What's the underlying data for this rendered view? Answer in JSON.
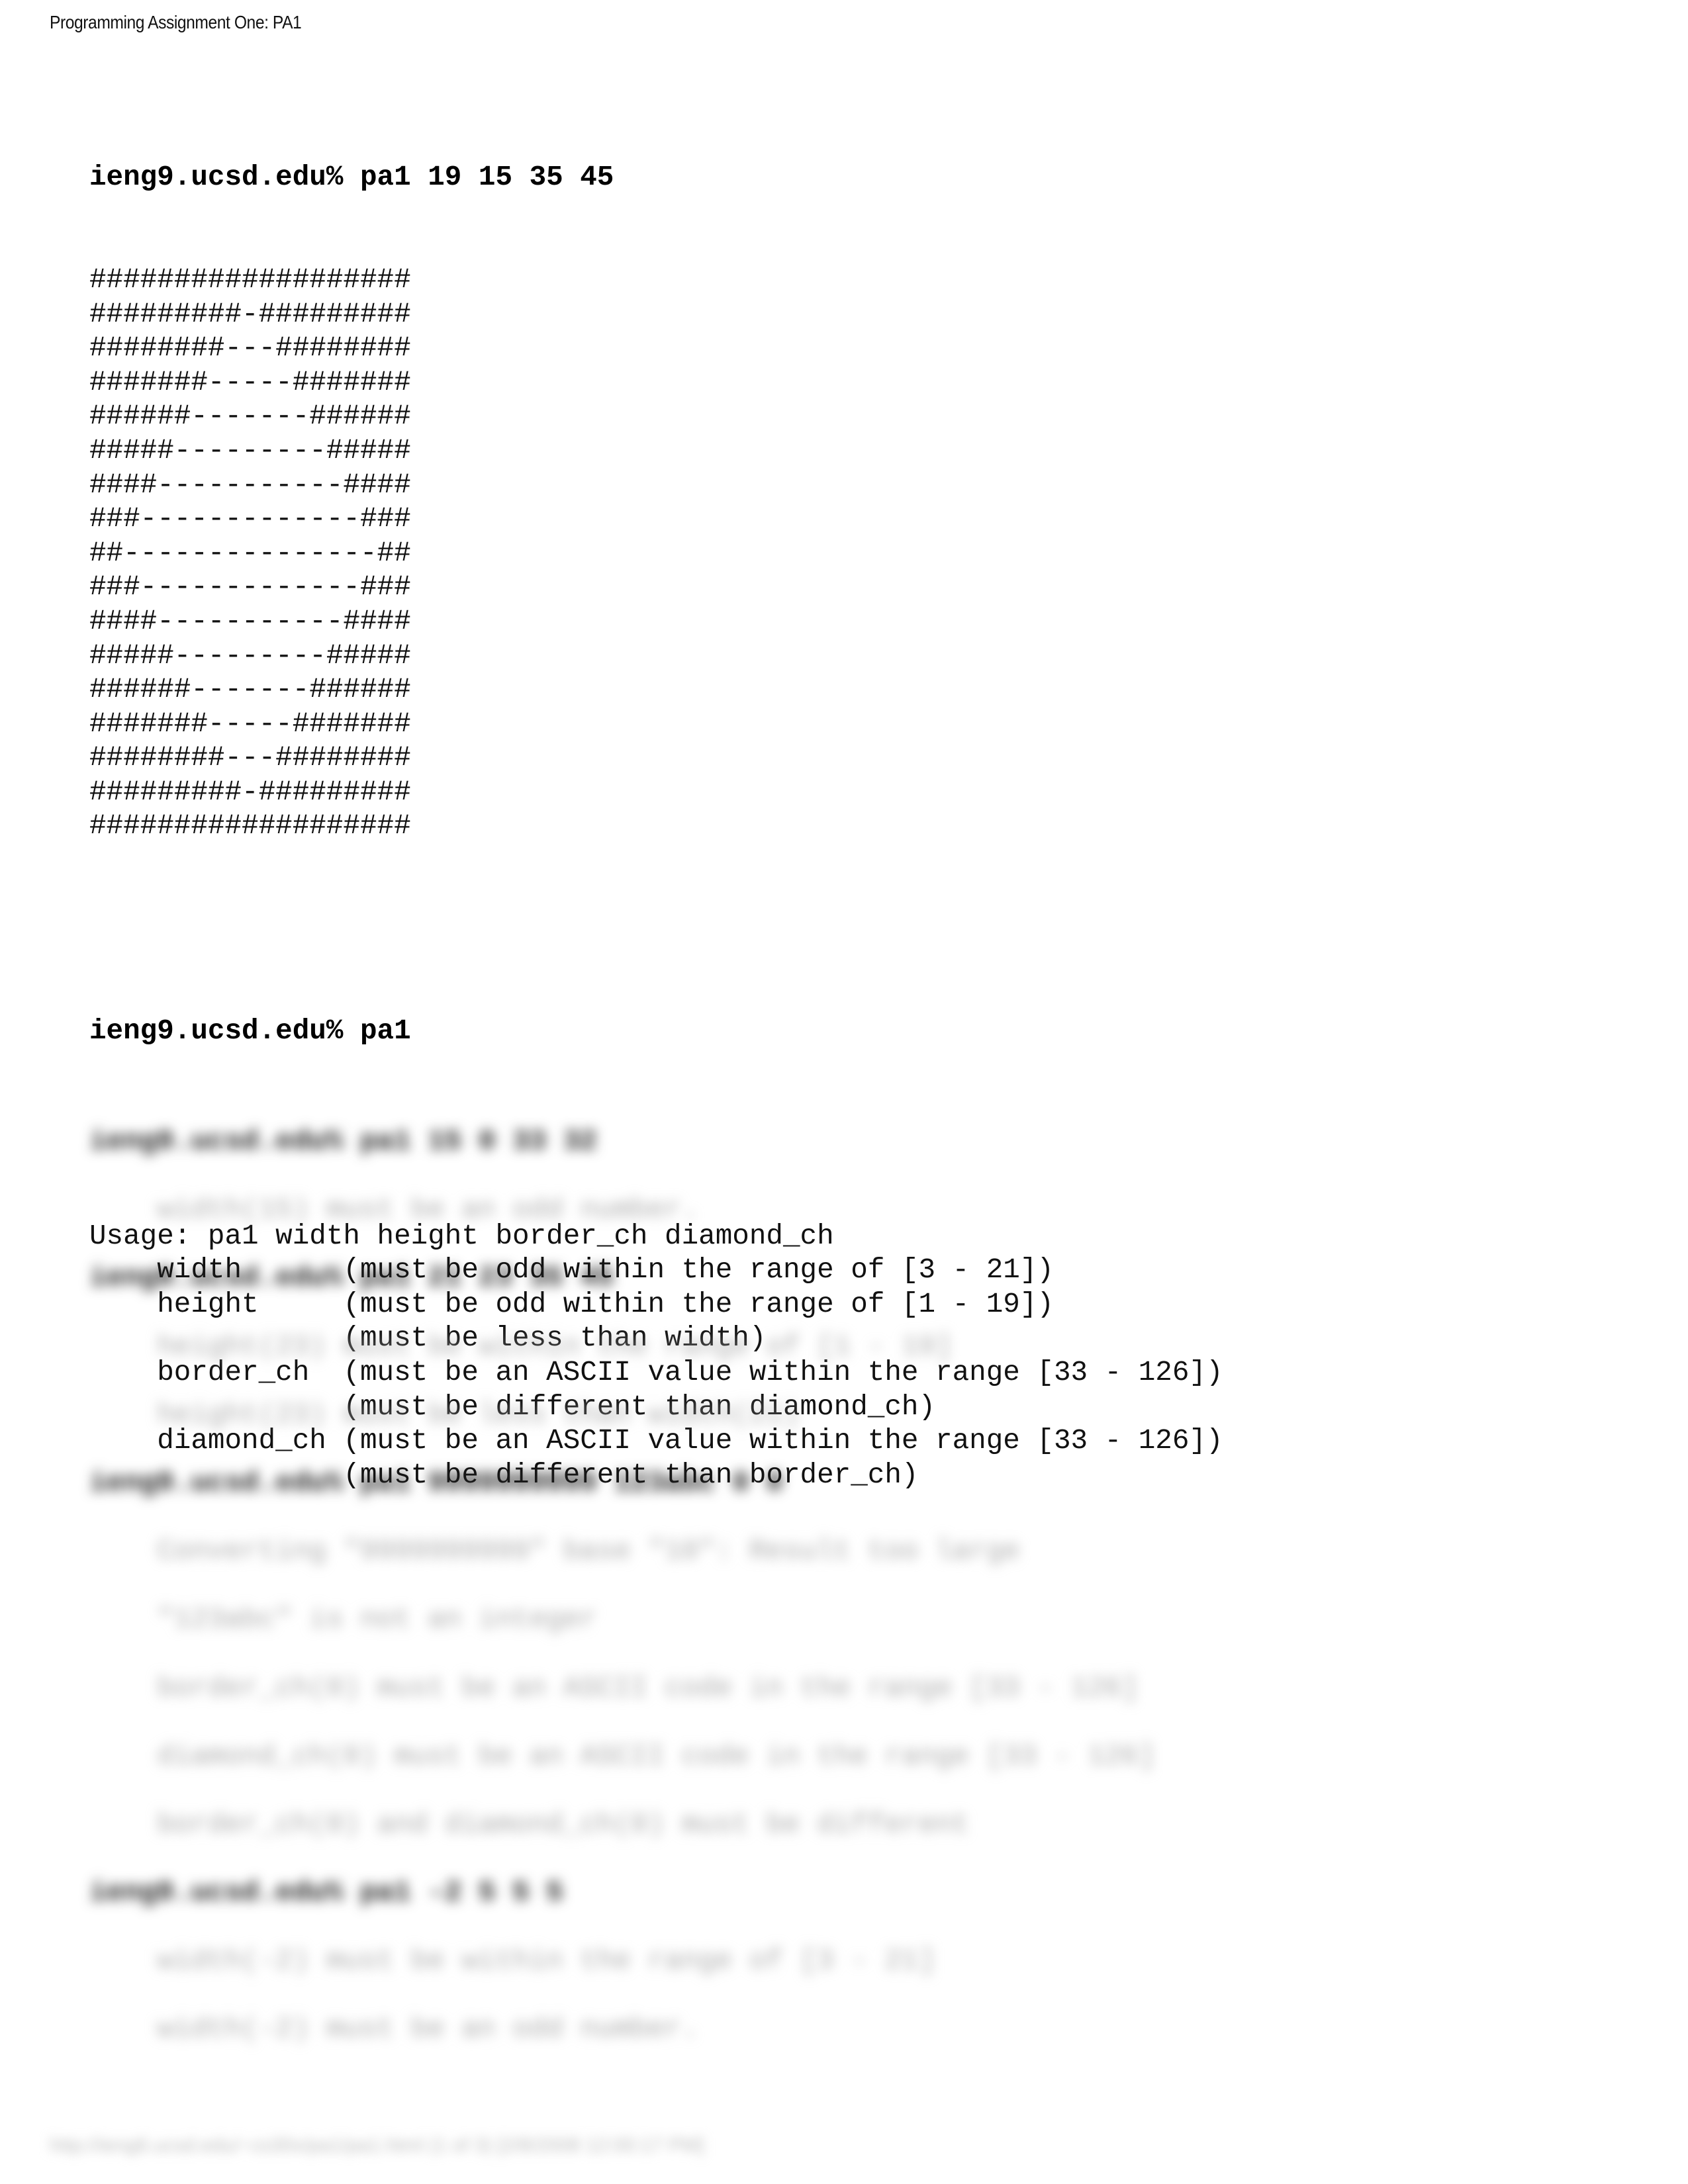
{
  "header": {
    "title": "Programming Assignment One: PA1"
  },
  "session1": {
    "prompt": "ieng9.ucsd.edu% pa1 19 15 35 45",
    "diamond_rows": [
      "###################",
      "#########-#########",
      "########---########",
      "#######-----#######",
      "######-------######",
      "#####---------#####",
      "####-----------####",
      "###-------------###",
      "##---------------##",
      "###-------------###",
      "####-----------####",
      "#####---------#####",
      "######-------######",
      "#######-----#######",
      "########---########",
      "#########-#########",
      "###################"
    ]
  },
  "session2": {
    "prompt": "ieng9.ucsd.edu% pa1",
    "usage_lines": [
      "Usage: pa1 width height border_ch diamond_ch",
      "    width      (must be odd within the range of [3 - 21])",
      "    height     (must be odd within the range of [1 - 19])",
      "               (must be less than width)",
      "    border_ch  (must be an ASCII value within the range [33 - 126])",
      "               (must be different than diamond_ch)",
      "    diamond_ch (must be an ASCII value within the range [33 - 126])",
      "               (must be different than border_ch)"
    ]
  },
  "blurred": {
    "blocks": [
      {
        "prompt": "ieng9.ucsd.edu% pa1 15 0 33 32",
        "messages": [
          "    width(15) must be an odd number."
        ]
      },
      {
        "prompt": "ieng9.ucsd.edu% pa1 21 23 35 45",
        "messages": [
          "    height(23) must be within the range of [1 - 19]",
          "    height(23) must be less than width(21)"
        ]
      },
      {
        "prompt": "ieng9.ucsd.edu% pa1 9999999999 123abc 0 0",
        "messages": [
          "    Converting \"9999999999\" base \"10\": Result too large",
          "    \"123abc\" is not an integer",
          "    border_ch(0) must be an ASCII code in the range [33 - 126]",
          "    diamond_ch(0) must be an ASCII code in the range [33 - 126]",
          "    border_ch(0) and diamond_ch(0) must be different"
        ]
      },
      {
        "prompt": "ieng9.ucsd.edu% pa1 -2 5 5 5",
        "messages": [
          "    width(-2) must be within the range of [3 - 21]",
          "    width(-2) must be an odd number."
        ]
      }
    ]
  },
  "footer": {
    "text": "http://ieng6.ucsd.edu/~cs30x/pa1/pa1.html (1 of 3) [2/8/2008 12:00:17 PM]"
  }
}
